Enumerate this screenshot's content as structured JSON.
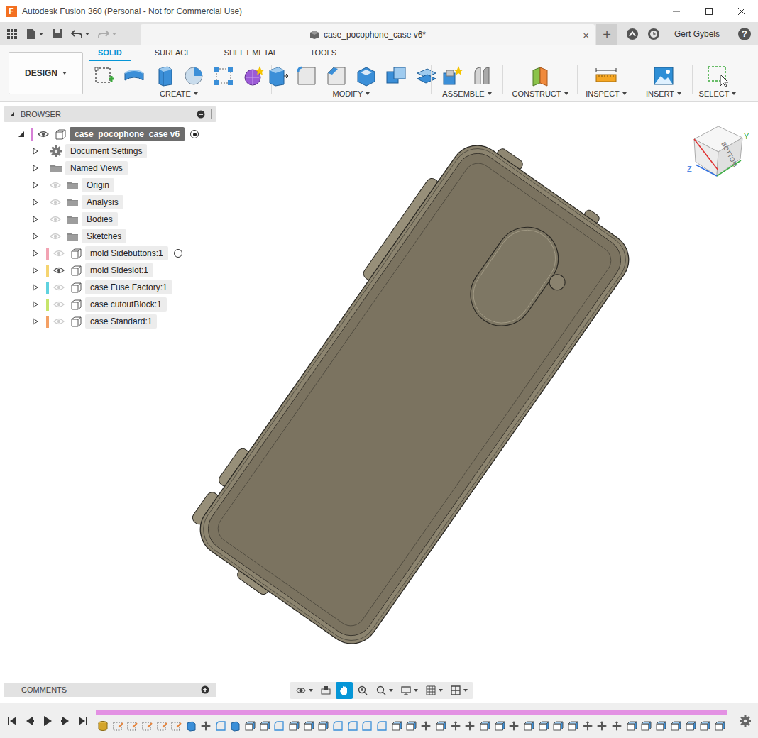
{
  "window": {
    "title": "Autodesk Fusion 360 (Personal - Not for Commercial Use)",
    "app_icon": "F"
  },
  "tab_bar": {
    "document": {
      "label": "case_pocophone_case v6*",
      "close": "×"
    },
    "new_tab": "+",
    "user": "Gert Gybels",
    "help": "?"
  },
  "workspace": {
    "label": "DESIGN"
  },
  "toolbar_tabs": [
    {
      "label": "SOLID",
      "selected": true
    },
    {
      "label": "SURFACE",
      "selected": false
    },
    {
      "label": "SHEET METAL",
      "selected": false
    },
    {
      "label": "TOOLS",
      "selected": false
    }
  ],
  "toolbar_groups": [
    {
      "label": "CREATE"
    },
    {
      "label": "MODIFY"
    },
    {
      "label": "ASSEMBLE"
    },
    {
      "label": "CONSTRUCT"
    },
    {
      "label": "INSPECT"
    },
    {
      "label": "INSERT"
    },
    {
      "label": "SELECT"
    }
  ],
  "browser": {
    "title": "BROWSER",
    "root": {
      "label": "case_pocophone_case v6",
      "expanded": true,
      "visible": true,
      "active": true,
      "selected": true,
      "color": "#d67fd6"
    },
    "items": [
      {
        "label": "Document Settings",
        "kind": "settings",
        "expanded": false,
        "selected": false
      },
      {
        "label": "Named Views",
        "kind": "views",
        "expanded": false,
        "selected": false
      },
      {
        "label": "Origin",
        "kind": "folder",
        "expanded": false,
        "visible": false,
        "selected": false
      },
      {
        "label": "Analysis",
        "kind": "folder",
        "expanded": false,
        "visible": false,
        "selected": false
      },
      {
        "label": "Bodies",
        "kind": "folder",
        "expanded": false,
        "visible": false,
        "selected": false
      },
      {
        "label": "Sketches",
        "kind": "folder",
        "expanded": false,
        "visible": false,
        "selected": false
      },
      {
        "label": "mold Sidebuttons:1",
        "kind": "component",
        "expanded": false,
        "visible": false,
        "selected": false,
        "radio": true,
        "active": false,
        "color": "#f2a3b3"
      },
      {
        "label": "mold Sideslot:1",
        "kind": "component",
        "expanded": false,
        "visible": true,
        "selected": false,
        "radio": false,
        "active": false,
        "color": "#f5d470"
      },
      {
        "label": "case Fuse Factory:1",
        "kind": "component",
        "expanded": false,
        "visible": false,
        "selected": false,
        "radio": false,
        "active": false,
        "color": "#5fd2df"
      },
      {
        "label": "case cutoutBlock:1",
        "kind": "component",
        "expanded": false,
        "visible": false,
        "selected": false,
        "radio": false,
        "active": false,
        "color": "#c6e56b"
      },
      {
        "label": "case Standard:1",
        "kind": "component",
        "expanded": false,
        "visible": false,
        "selected": false,
        "radio": false,
        "active": false,
        "color": "#f4a064"
      }
    ]
  },
  "comments": {
    "title": "COMMENTS"
  },
  "viewcube": {
    "face": "BOTTOM",
    "axes": [
      {
        "label": "Y",
        "color": "#3cb043"
      },
      {
        "label": "Z",
        "color": "#2f6fe0"
      }
    ]
  },
  "nav_tools": [
    {
      "kind": "orbit",
      "dropdown": true,
      "selected": false
    },
    {
      "kind": "look-at",
      "dropdown": false,
      "selected": false
    },
    {
      "kind": "pan",
      "dropdown": false,
      "selected": true
    },
    {
      "kind": "zoom",
      "dropdown": false,
      "selected": false
    },
    {
      "kind": "fit",
      "dropdown": true,
      "selected": false
    },
    {
      "kind": "display",
      "dropdown": true,
      "selected": false
    },
    {
      "kind": "grid",
      "dropdown": true,
      "selected": false
    },
    {
      "kind": "viewports",
      "dropdown": true,
      "selected": false
    }
  ]
}
